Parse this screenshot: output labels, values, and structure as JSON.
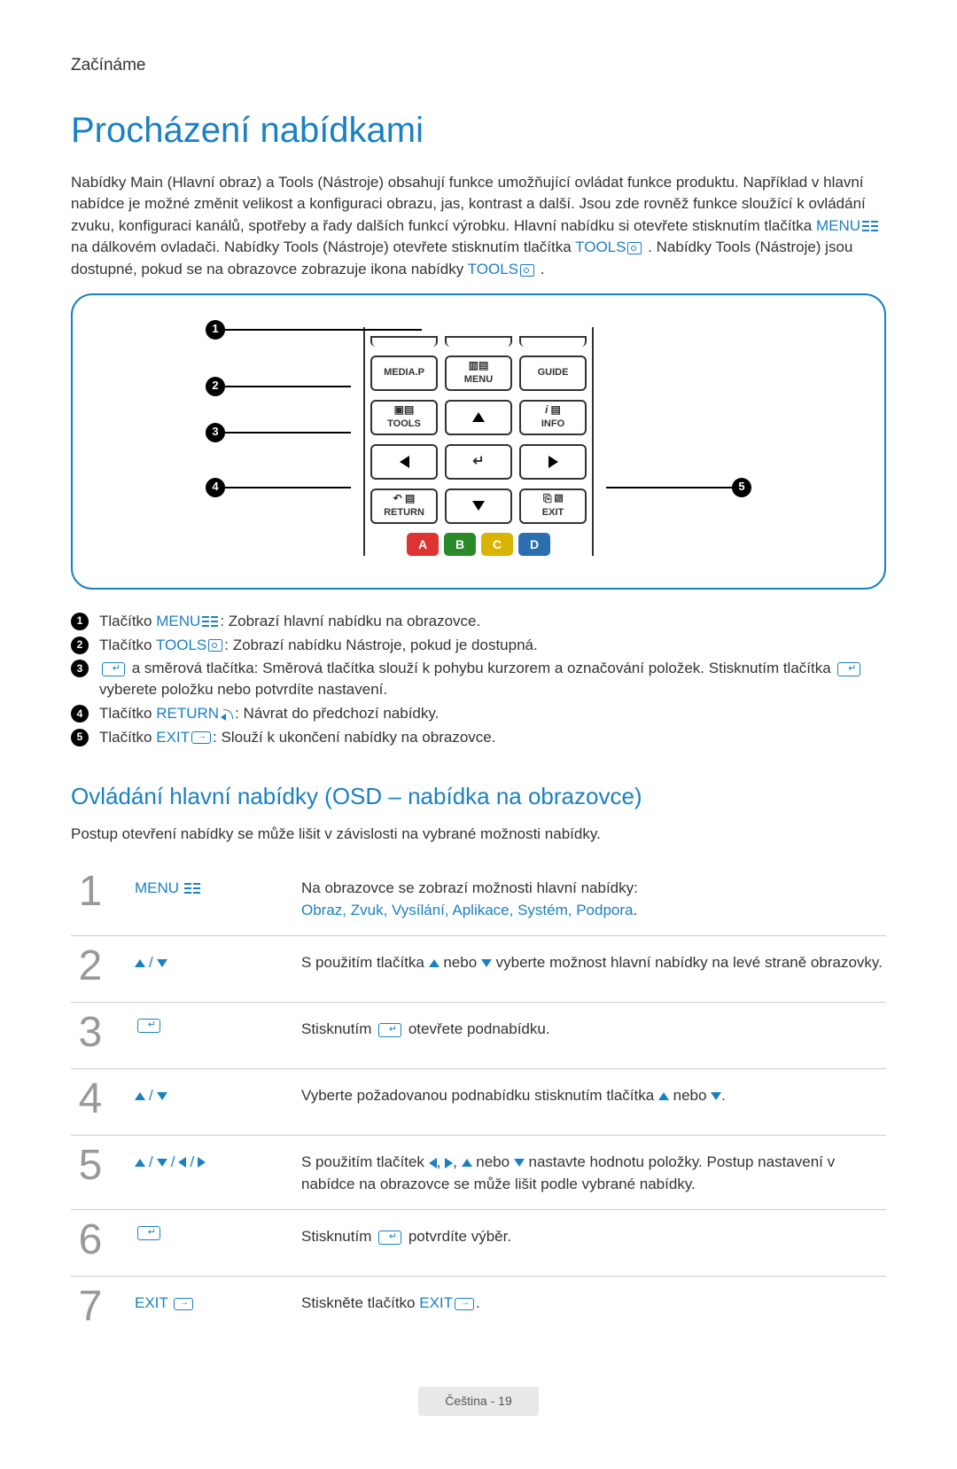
{
  "section_label": "Začínáme",
  "page_title": "Procházení nabídkami",
  "intro_p1_a": "Nabídky Main (Hlavní obraz) a Tools (Nástroje) obsahují funkce umožňující ovládat funkce produktu. Například v hlavní nabídce je možné změnit velikost a konfiguraci obrazu, jas, kontrast a další. Jsou zde rovněž funkce sloužící k ovládání zvuku, konfiguraci kanálů, spotřeby a řady dalších funkcí výrobku. Hlavní nabídku si otevřete stisknutím tlačítka ",
  "intro_menu": "MENU",
  "intro_p1_b": " na dálkovém ovladači. Nabídky Tools (Nástroje) otevřete stisknutím tlačítka ",
  "intro_tools": "TOOLS",
  "intro_p1_c": ". Nabídky Tools (Nástroje) jsou dostupné, pokud se na obrazovce zobrazuje ikona nabídky ",
  "intro_tools2": "TOOLS",
  "intro_p1_d": ".",
  "remote": {
    "mediap": "MEDIA.P",
    "menu": "MENU",
    "guide": "GUIDE",
    "tools": "TOOLS",
    "info": "INFO",
    "return": "RETURN",
    "exit": "EXIT",
    "colorA": "A",
    "colorB": "B",
    "colorC": "C",
    "colorD": "D",
    "info_i": "i"
  },
  "legend": {
    "l1_a": "Tlačítko ",
    "l1_kw": "MENU",
    "l1_b": ": Zobrazí hlavní nabídku na obrazovce.",
    "l2_a": "Tlačítko ",
    "l2_kw": "TOOLS",
    "l2_b": ": Zobrazí nabídku Nástroje, pokud je dostupná.",
    "l3_a": " a směrová tlačítka: Směrová tlačítka slouží k pohybu kurzorem a označování položek. Stisknutím tlačítka ",
    "l3_b": " vyberete položku nebo potvrdíte nastavení.",
    "l4_a": "Tlačítko ",
    "l4_kw": "RETURN",
    "l4_b": ": Návrat do předchozí nabídky.",
    "l5_a": "Tlačítko ",
    "l5_kw": "EXIT",
    "l5_b": ": Slouží k ukončení nabídky na obrazovce."
  },
  "subheading": "Ovládání hlavní nabídky (OSD – nabídka na obrazovce)",
  "steps_intro": "Postup otevření nabídky se může lišit v závislosti na vybrané možnosti nabídky.",
  "steps": {
    "s1": {
      "num": "1",
      "key": "MENU",
      "desc_a": "Na obrazovce se zobrazí možnosti hlavní nabídky:",
      "opts": "Obraz, Zvuk, Vysílání, Aplikace, Systém, Podpora",
      "opts_suffix": "."
    },
    "s2": {
      "num": "2",
      "desc_a": "S použitím tlačítka ",
      "desc_b": " nebo ",
      "desc_c": " vyberte možnost hlavní nabídky na levé straně obrazovky."
    },
    "s3": {
      "num": "3",
      "desc_a": "Stisknutím ",
      "desc_b": " otevřete podnabídku."
    },
    "s4": {
      "num": "4",
      "desc_a": "Vyberte požadovanou podnabídku stisknutím tlačítka ",
      "desc_b": " nebo ",
      "desc_c": "."
    },
    "s5": {
      "num": "5",
      "desc_a": "S použitím tlačítek ",
      "desc_b": ", ",
      "desc_c": ", ",
      "desc_d": " nebo ",
      "desc_e": " nastavte hodnotu položky. Postup nastavení v nabídce na obrazovce se může lišit podle vybrané nabídky."
    },
    "s6": {
      "num": "6",
      "desc_a": "Stisknutím ",
      "desc_b": " potvrdíte výběr."
    },
    "s7": {
      "num": "7",
      "key": "EXIT",
      "desc_a": "Stiskněte tlačítko ",
      "desc_kw": "EXIT",
      "desc_b": "."
    }
  },
  "footer": "Čeština - 19"
}
